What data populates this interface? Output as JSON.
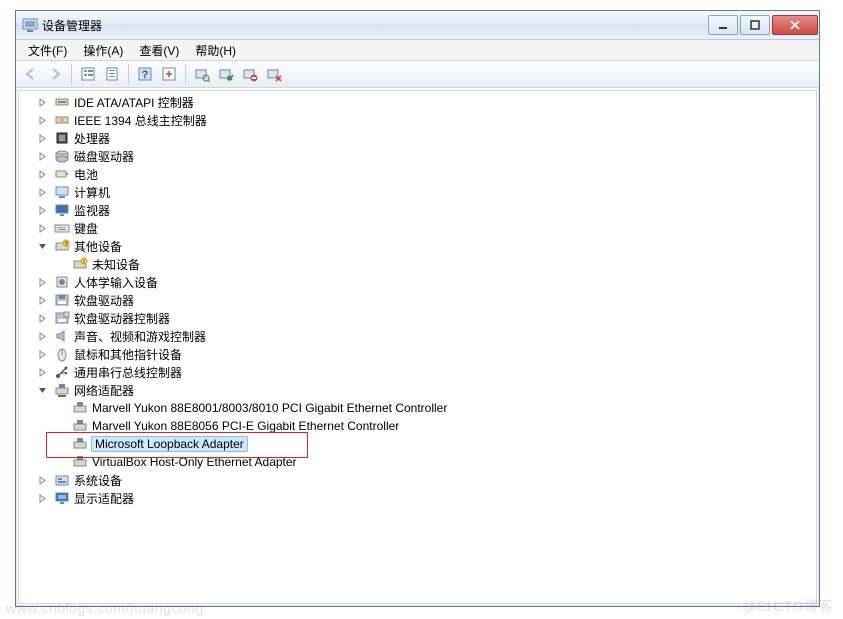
{
  "window": {
    "title": "设备管理器"
  },
  "menu": {
    "file": "文件(F)",
    "action": "操作(A)",
    "view": "查看(V)",
    "help": "帮助(H)"
  },
  "toolbar": {
    "back": "后退",
    "forward": "前进",
    "show_tree": "显示树",
    "properties": "属性",
    "help": "帮助",
    "action": "操作",
    "scan": "扫描检测硬件改动",
    "enable": "启用",
    "disable": "停用",
    "uninstall": "卸载"
  },
  "tree": {
    "items": [
      {
        "icon": "ide",
        "label": "IDE ATA/ATAPI 控制器",
        "state": "collapsed"
      },
      {
        "icon": "ieee",
        "label": "IEEE 1394 总线主控制器",
        "state": "collapsed"
      },
      {
        "icon": "cpu",
        "label": "处理器",
        "state": "collapsed"
      },
      {
        "icon": "disk",
        "label": "磁盘驱动器",
        "state": "collapsed"
      },
      {
        "icon": "battery",
        "label": "电池",
        "state": "collapsed"
      },
      {
        "icon": "computer",
        "label": "计算机",
        "state": "collapsed"
      },
      {
        "icon": "monitor",
        "label": "监视器",
        "state": "collapsed"
      },
      {
        "icon": "keyboard",
        "label": "键盘",
        "state": "collapsed"
      },
      {
        "icon": "other",
        "label": "其他设备",
        "state": "expanded",
        "children": [
          {
            "icon": "unknown",
            "label": "未知设备",
            "state": "leaf"
          }
        ]
      },
      {
        "icon": "hid",
        "label": "人体学输入设备",
        "state": "collapsed"
      },
      {
        "icon": "floppy",
        "label": "软盘驱动器",
        "state": "collapsed"
      },
      {
        "icon": "floppyctl",
        "label": "软盘驱动器控制器",
        "state": "collapsed"
      },
      {
        "icon": "sound",
        "label": "声音、视频和游戏控制器",
        "state": "collapsed"
      },
      {
        "icon": "mouse",
        "label": "鼠标和其他指针设备",
        "state": "collapsed"
      },
      {
        "icon": "usb",
        "label": "通用串行总线控制器",
        "state": "collapsed"
      },
      {
        "icon": "network",
        "label": "网络适配器",
        "state": "expanded",
        "children": [
          {
            "icon": "nic",
            "label": "Marvell Yukon 88E8001/8003/8010 PCI Gigabit Ethernet Controller",
            "state": "leaf"
          },
          {
            "icon": "nic",
            "label": "Marvell Yukon 88E8056 PCI-E Gigabit Ethernet Controller",
            "state": "leaf"
          },
          {
            "icon": "nic",
            "label": "Microsoft Loopback Adapter",
            "state": "leaf",
            "selected": true,
            "highlighted": true
          },
          {
            "icon": "nic",
            "label": "VirtualBox Host-Only Ethernet Adapter",
            "state": "leaf"
          }
        ]
      },
      {
        "icon": "system",
        "label": "系统设备",
        "state": "collapsed"
      },
      {
        "icon": "display",
        "label": "显示适配器",
        "state": "collapsed"
      }
    ]
  },
  "watermark": {
    "left": "www.cnblogs.com/huangcong",
    "right": "@51CTO博客"
  }
}
